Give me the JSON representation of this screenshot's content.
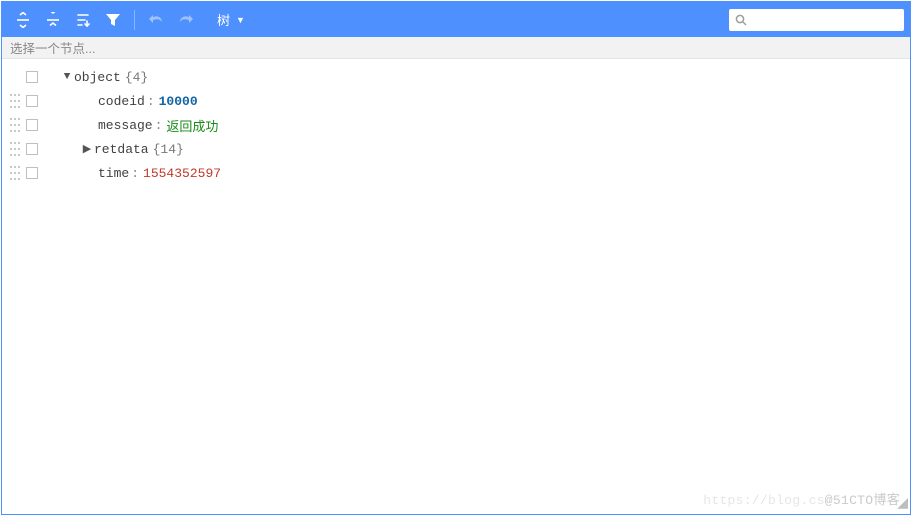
{
  "toolbar": {
    "view_label": "树",
    "search_placeholder": ""
  },
  "selector_bar": {
    "placeholder": "选择一个节点..."
  },
  "tree": {
    "root_label": "object",
    "root_count": "{4}",
    "rows": [
      {
        "key": "codeid",
        "value": "10000",
        "vclass": "v-num-blue"
      },
      {
        "key": "message",
        "value": "返回成功",
        "vclass": "v-str"
      },
      {
        "key": "retdata",
        "count": "{14}",
        "expandable": true
      },
      {
        "key": "time",
        "value": "1554352597",
        "vclass": "v-num"
      }
    ]
  },
  "watermark": {
    "faded": "https://blog.cs",
    "text": "@51CTO博客"
  }
}
